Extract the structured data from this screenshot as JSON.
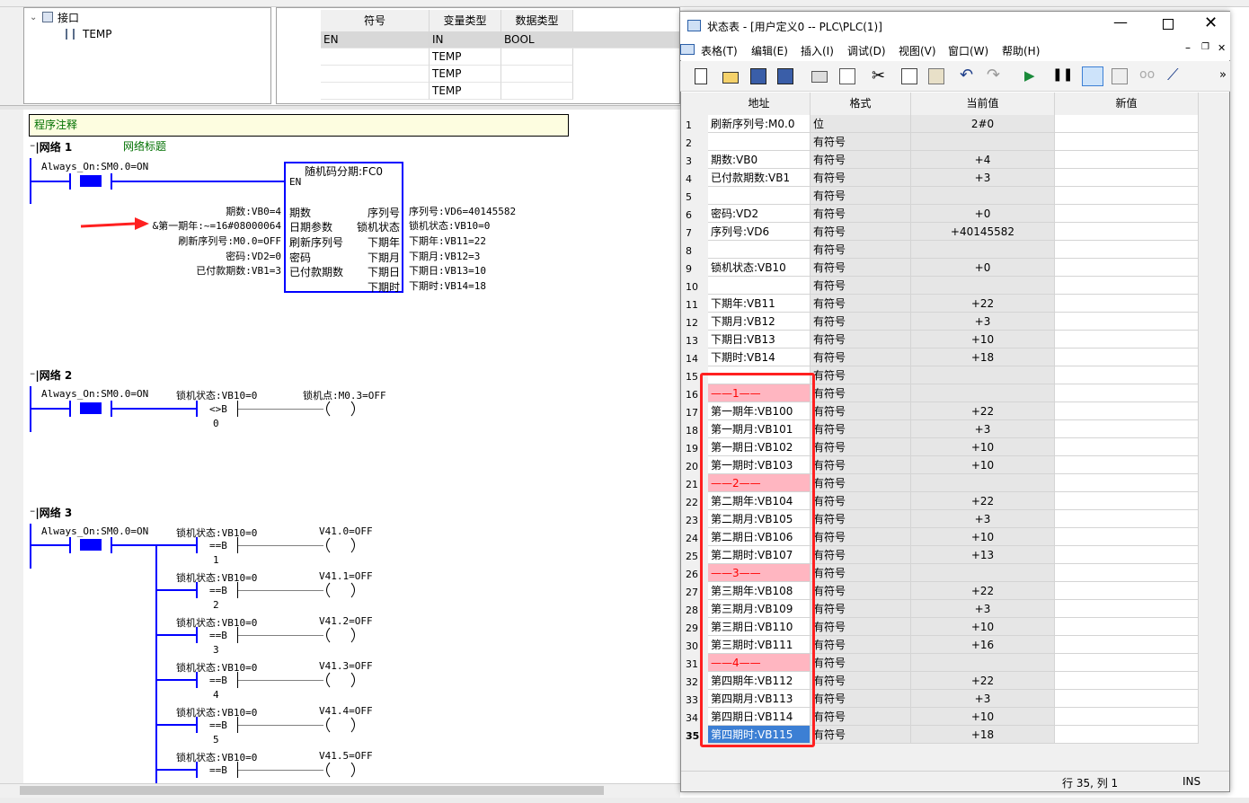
{
  "tree": {
    "interface_label": "接口",
    "temp_label": "TEMP"
  },
  "var_table": {
    "headers": [
      "符号",
      "变量类型",
      "数据类型"
    ],
    "rows": [
      {
        "symbol": "EN",
        "var_type": "IN",
        "data_type": "BOOL"
      },
      {
        "symbol": "",
        "var_type": "TEMP",
        "data_type": ""
      },
      {
        "symbol": "",
        "var_type": "TEMP",
        "data_type": ""
      },
      {
        "symbol": "",
        "var_type": "TEMP",
        "data_type": ""
      }
    ]
  },
  "editor": {
    "program_comment": "程序注释",
    "net1": {
      "label": "网络 1",
      "title": "网络标题",
      "contact": "Always_On:SM0.0=ON",
      "block_title": "随机码分期:FC0",
      "block_en": "EN",
      "inputs": [
        "期数",
        "日期参数",
        "刷新序列号",
        "密码",
        "已付款期数"
      ],
      "input_values": [
        "期数:VB0=4",
        "&第一期年:~=16#08000064",
        "刷新序列号:M0.0=OFF",
        "密码:VD2=0",
        "已付款期数:VB1=3"
      ],
      "outputs": [
        "序列号",
        "锁机状态",
        "下期年",
        "下期月",
        "下期日",
        "下期时"
      ],
      "output_values": [
        "序列号:VD6=40145582",
        "锁机状态:VB10=0",
        "下期年:VB11=22",
        "下期月:VB12=3",
        "下期日:VB13=10",
        "下期时:VB14=18"
      ]
    },
    "net2": {
      "label": "网络 2",
      "contact": "Always_On:SM0.0=ON",
      "compare": "锁机状态:VB10=0",
      "compare_op": "<>B",
      "compare_val": "0",
      "coil": "锁机点:M0.3=OFF"
    },
    "net3": {
      "label": "网络 3",
      "contact": "Always_On:SM0.0=ON",
      "rungs": [
        {
          "compare": "锁机状态:VB10=0",
          "op": "==B",
          "val": "1",
          "coil": "V41.0=OFF"
        },
        {
          "compare": "锁机状态:VB10=0",
          "op": "==B",
          "val": "2",
          "coil": "V41.1=OFF"
        },
        {
          "compare": "锁机状态:VB10=0",
          "op": "==B",
          "val": "3",
          "coil": "V41.2=OFF"
        },
        {
          "compare": "锁机状态:VB10=0",
          "op": "==B",
          "val": "4",
          "coil": "V41.3=OFF"
        },
        {
          "compare": "锁机状态:VB10=0",
          "op": "==B",
          "val": "5",
          "coil": "V41.4=OFF"
        },
        {
          "compare": "锁机状态:VB10=0",
          "op": "==B",
          "val": "",
          "coil": "V41.5=OFF"
        }
      ]
    }
  },
  "status_window": {
    "title": "状态表 - [用户定义0 -- PLC\\PLC(1)]",
    "menus": [
      "表格(T)",
      "编辑(E)",
      "插入(I)",
      "调试(D)",
      "视图(V)",
      "窗口(W)",
      "帮助(H)"
    ],
    "columns": [
      "地址",
      "格式",
      "当前值",
      "新值"
    ],
    "rows": [
      {
        "n": "1",
        "addr": "刷新序列号:M0.0",
        "fmt": "位",
        "cur": "2#0"
      },
      {
        "n": "2",
        "addr": "",
        "fmt": "有符号",
        "cur": ""
      },
      {
        "n": "3",
        "addr": "期数:VB0",
        "fmt": "有符号",
        "cur": "+4"
      },
      {
        "n": "4",
        "addr": "已付款期数:VB1",
        "fmt": "有符号",
        "cur": "+3"
      },
      {
        "n": "5",
        "addr": "",
        "fmt": "有符号",
        "cur": ""
      },
      {
        "n": "6",
        "addr": "密码:VD2",
        "fmt": "有符号",
        "cur": "+0"
      },
      {
        "n": "7",
        "addr": "序列号:VD6",
        "fmt": "有符号",
        "cur": "+40145582"
      },
      {
        "n": "8",
        "addr": "",
        "fmt": "有符号",
        "cur": ""
      },
      {
        "n": "9",
        "addr": "锁机状态:VB10",
        "fmt": "有符号",
        "cur": "+0"
      },
      {
        "n": "10",
        "addr": "",
        "fmt": "有符号",
        "cur": ""
      },
      {
        "n": "11",
        "addr": "下期年:VB11",
        "fmt": "有符号",
        "cur": "+22"
      },
      {
        "n": "12",
        "addr": "下期月:VB12",
        "fmt": "有符号",
        "cur": "+3"
      },
      {
        "n": "13",
        "addr": "下期日:VB13",
        "fmt": "有符号",
        "cur": "+10"
      },
      {
        "n": "14",
        "addr": "下期时:VB14",
        "fmt": "有符号",
        "cur": "+18"
      },
      {
        "n": "15",
        "addr": "",
        "fmt": "有符号",
        "cur": ""
      },
      {
        "n": "16",
        "addr": "——1——",
        "fmt": "有符号",
        "cur": "",
        "sep": true
      },
      {
        "n": "17",
        "addr": "第一期年:VB100",
        "fmt": "有符号",
        "cur": "+22"
      },
      {
        "n": "18",
        "addr": "第一期月:VB101",
        "fmt": "有符号",
        "cur": "+3"
      },
      {
        "n": "19",
        "addr": "第一期日:VB102",
        "fmt": "有符号",
        "cur": "+10"
      },
      {
        "n": "20",
        "addr": "第一期时:VB103",
        "fmt": "有符号",
        "cur": "+10"
      },
      {
        "n": "21",
        "addr": "——2——",
        "fmt": "有符号",
        "cur": "",
        "sep": true
      },
      {
        "n": "22",
        "addr": "第二期年:VB104",
        "fmt": "有符号",
        "cur": "+22"
      },
      {
        "n": "23",
        "addr": "第二期月:VB105",
        "fmt": "有符号",
        "cur": "+3"
      },
      {
        "n": "24",
        "addr": "第二期日:VB106",
        "fmt": "有符号",
        "cur": "+10"
      },
      {
        "n": "25",
        "addr": "第二期时:VB107",
        "fmt": "有符号",
        "cur": "+13"
      },
      {
        "n": "26",
        "addr": "——3——",
        "fmt": "有符号",
        "cur": "",
        "sep": true
      },
      {
        "n": "27",
        "addr": "第三期年:VB108",
        "fmt": "有符号",
        "cur": "+22"
      },
      {
        "n": "28",
        "addr": "第三期月:VB109",
        "fmt": "有符号",
        "cur": "+3"
      },
      {
        "n": "29",
        "addr": "第三期日:VB110",
        "fmt": "有符号",
        "cur": "+10"
      },
      {
        "n": "30",
        "addr": "第三期时:VB111",
        "fmt": "有符号",
        "cur": "+16"
      },
      {
        "n": "31",
        "addr": "——4——",
        "fmt": "有符号",
        "cur": "",
        "sep": true
      },
      {
        "n": "32",
        "addr": "第四期年:VB112",
        "fmt": "有符号",
        "cur": "+22"
      },
      {
        "n": "33",
        "addr": "第四期月:VB113",
        "fmt": "有符号",
        "cur": "+3"
      },
      {
        "n": "34",
        "addr": "第四期日:VB114",
        "fmt": "有符号",
        "cur": "+10"
      },
      {
        "n": "35",
        "addr": "第四期时:VB115",
        "fmt": "有符号",
        "cur": "+18",
        "selected": true
      }
    ],
    "status_position": "行 35, 列 1",
    "status_mode": "INS"
  },
  "colors": {
    "ladder_blue": "#0000ff",
    "highlight_red": "#ff2020",
    "separator_pink": "#ffb6c1",
    "selection_blue": "#3c7fd4",
    "comment_green": "#007000"
  }
}
